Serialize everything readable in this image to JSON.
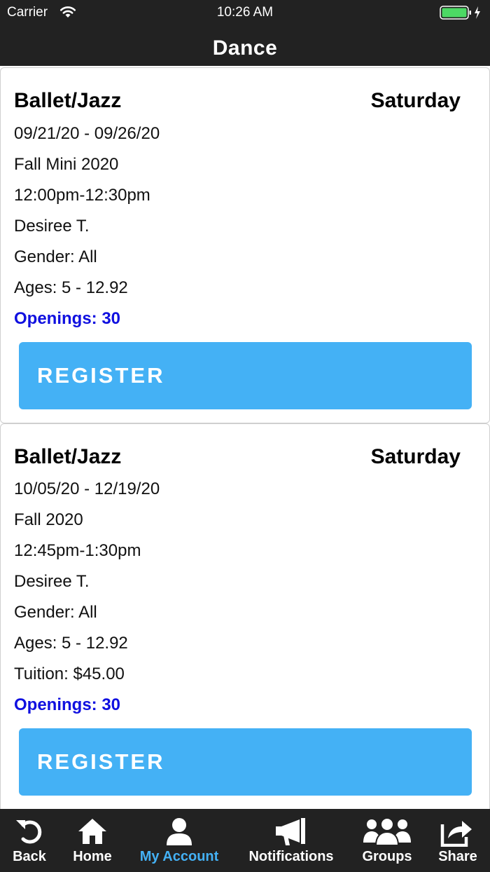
{
  "status_bar": {
    "carrier": "Carrier",
    "time": "10:26 AM",
    "wifi_icon": "wifi-icon",
    "battery_icon": "battery-charging-icon"
  },
  "nav": {
    "title": "Dance"
  },
  "classes": [
    {
      "name": "Ballet/Jazz",
      "day": "Saturday",
      "dates": "09/21/20 - 09/26/20",
      "session": "Fall Mini 2020",
      "time": "12:00pm-12:30pm",
      "instructor": "Desiree T.",
      "gender": "Gender: All",
      "ages": "Ages: 5 - 12.92",
      "openings": "Openings: 30",
      "register_label": "REGISTER"
    },
    {
      "name": "Ballet/Jazz",
      "day": "Saturday",
      "dates": "10/05/20 - 12/19/20",
      "session": "Fall 2020",
      "time": "12:45pm-1:30pm",
      "instructor": "Desiree T.",
      "gender": "Gender: All",
      "ages": "Ages: 5 - 12.92",
      "tuition": "Tuition: $45.00",
      "openings": "Openings: 30",
      "register_label": "REGISTER"
    }
  ],
  "tab_bar": {
    "active_color": "#44b1f5",
    "tabs": [
      {
        "label": "Back",
        "icon": "back-arrow-icon"
      },
      {
        "label": "Home",
        "icon": "home-icon"
      },
      {
        "label": "My Account",
        "icon": "user-icon",
        "active": true
      },
      {
        "label": "Notifications",
        "icon": "megaphone-icon"
      },
      {
        "label": "Groups",
        "icon": "group-icon"
      },
      {
        "label": "Share",
        "icon": "share-icon"
      }
    ]
  },
  "colors": {
    "bar_background": "#222222",
    "register_button": "#44b1f5",
    "openings_text": "#1010e0"
  }
}
